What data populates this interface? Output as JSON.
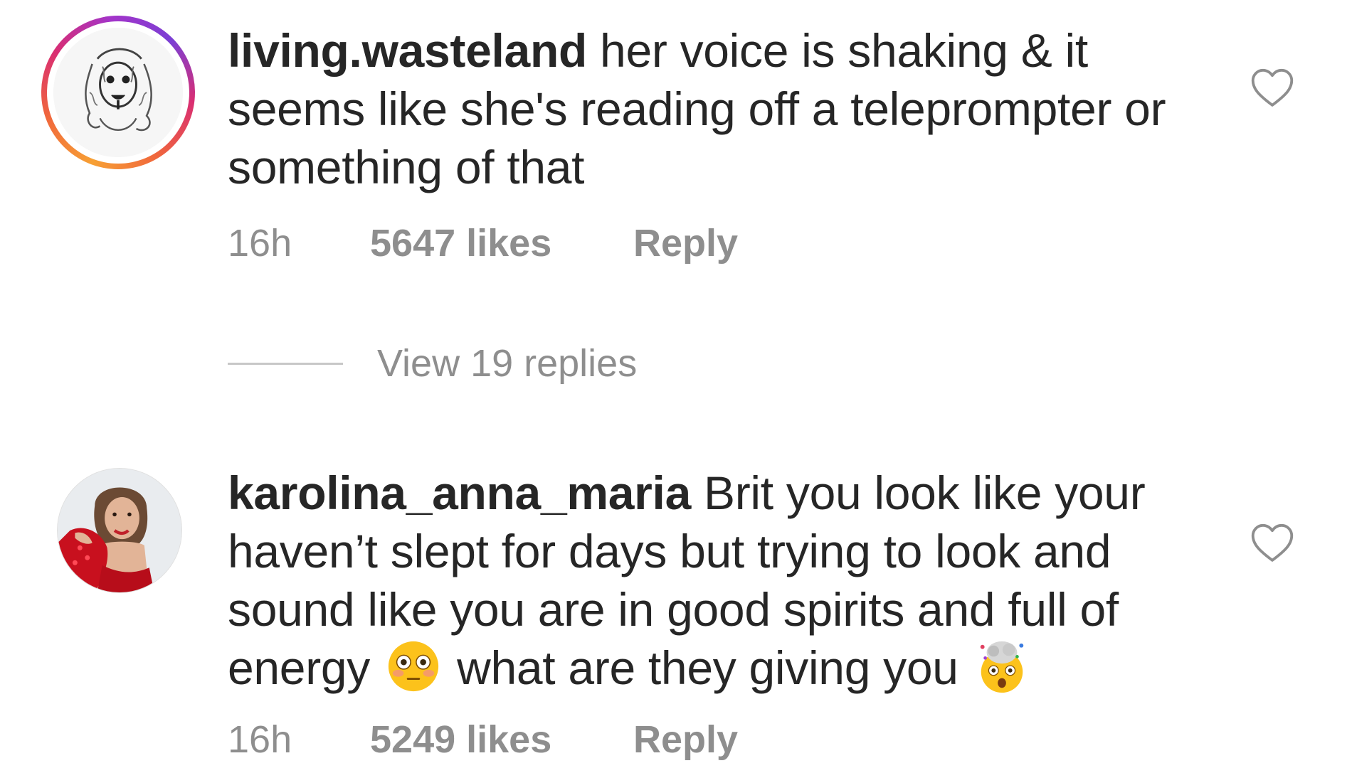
{
  "comments": [
    {
      "username": "living.wasteland",
      "body": "her voice is shaking & it seems like she's reading off a teleprompter or something of that",
      "time": "16h",
      "likes": "5647 likes",
      "reply_label": "Reply",
      "avatar_icon": "sketch-portrait-avatar",
      "has_story_ring": true
    },
    {
      "username": "karolina_anna_maria",
      "body_part1": "Brit you look like your haven’t slept for days but trying to look and sound like you are in good spirits and full of energy",
      "emoji1": "flushed-face-emoji",
      "body_part2": "what are they giving you",
      "emoji2": "exploding-head-emoji",
      "time": "16h",
      "likes": "5249 likes",
      "reply_label": "Reply",
      "avatar_icon": "photo-portrait-avatar",
      "has_story_ring": false
    }
  ],
  "view_replies_label": "View 19 replies",
  "colors": {
    "text": "#262626",
    "secondary": "#8e8e8e",
    "divider": "#c7c7c7",
    "ring_start": "#f7a034",
    "ring_mid": "#d92e72",
    "ring_end": "#7b3fd4"
  }
}
